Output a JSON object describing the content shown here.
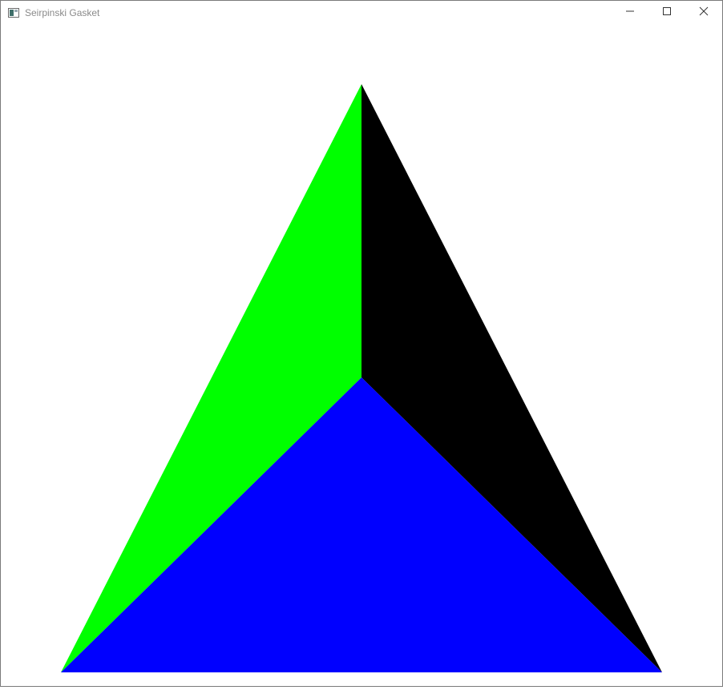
{
  "window": {
    "title": "Seirpinski Gasket",
    "controls": [
      "minimize",
      "maximize",
      "close"
    ]
  },
  "icons": {
    "app": "app-window-icon",
    "minimize": "minimize-icon",
    "maximize": "maximize-icon",
    "close": "close-icon"
  },
  "canvas": {
    "background": "#ffffff",
    "region_colors": {
      "left": "#00ff00",
      "right": "#000000",
      "bottom": "#0000ff"
    }
  }
}
